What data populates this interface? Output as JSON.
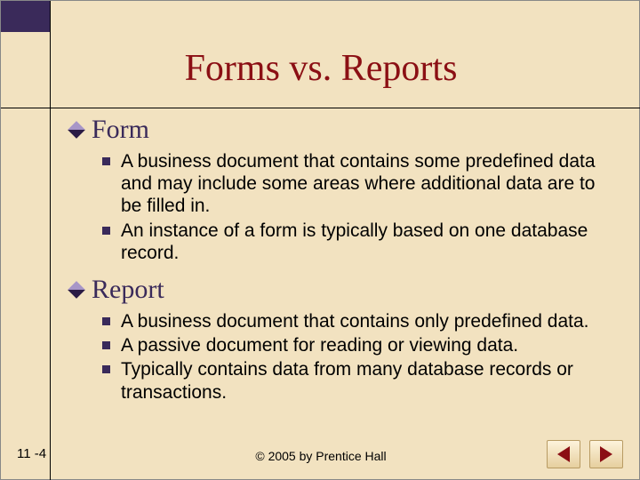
{
  "title": "Forms vs. Reports",
  "sections": [
    {
      "heading": "Form",
      "bullets": [
        "A business document that contains some predefined data and may include some areas where additional data are to be filled in.",
        "An instance of a form is typically based on one database record."
      ]
    },
    {
      "heading": "Report",
      "bullets": [
        "A business document that contains only predefined data.",
        "A passive document for reading or viewing data.",
        "Typically contains data from many database records or transactions."
      ]
    }
  ],
  "page_number": "11 -4",
  "copyright": "© 2005 by Prentice Hall"
}
